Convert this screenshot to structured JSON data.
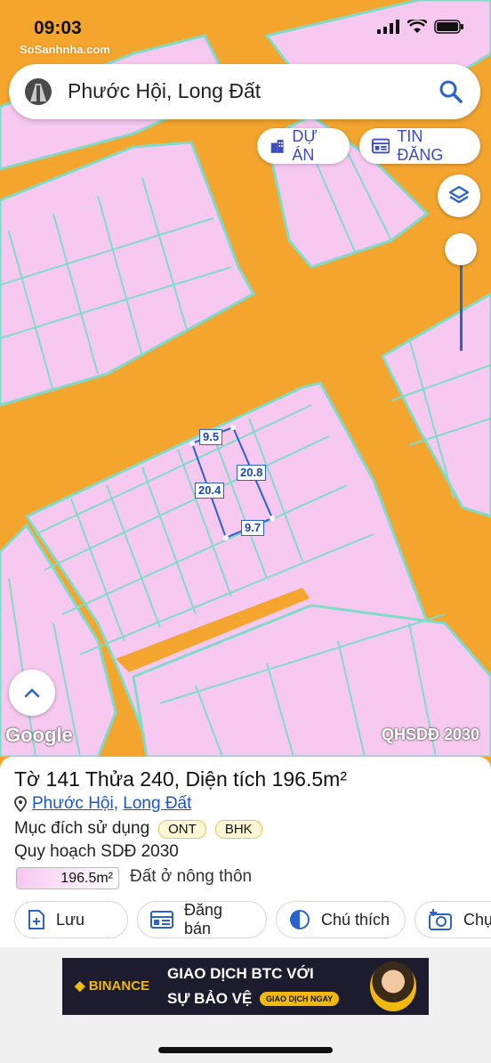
{
  "status_bar": {
    "time": "09:03",
    "watermark": "SoSanhnha.com"
  },
  "search": {
    "text": "Phước Hội, Long Đất"
  },
  "chips": {
    "project_label": "DỰ ÁN",
    "listing_label": "TIN ĐĂNG"
  },
  "map": {
    "dimension_labels": [
      "9.5",
      "20.8",
      "20.4",
      "9.7"
    ],
    "google_label": "Google",
    "plan_label": "QHSDĐ 2030",
    "colors": {
      "road": "#f4a52e",
      "parcel": "#f7c9f1",
      "parcel_border": "#7fdcc8",
      "selection": "#2a63c9"
    }
  },
  "parcel_info": {
    "title": "Tờ 141 Thửa 240, Diện tích 196.5m²",
    "location_1": "Phước Hội",
    "location_sep": ",",
    "location_2": "Long Đất",
    "purpose_label": "Mục đích sử dụng",
    "purpose_tags": [
      "ONT",
      "BHK"
    ],
    "plan_label": "Quy hoạch SDĐ 2030",
    "area_value": "196.5m²",
    "area_desc": "Đất ở nông thôn"
  },
  "actions": {
    "save": "Lưu",
    "post_sale": "Đăng bán",
    "legend": "Chú thích",
    "capture": "Chụ"
  },
  "ad": {
    "brand": "BINANCE",
    "line1": "GIAO DỊCH BTC VỚI",
    "line2": "SỰ BẢO VỆ",
    "button": "GIAO DỊCH NGAY"
  }
}
